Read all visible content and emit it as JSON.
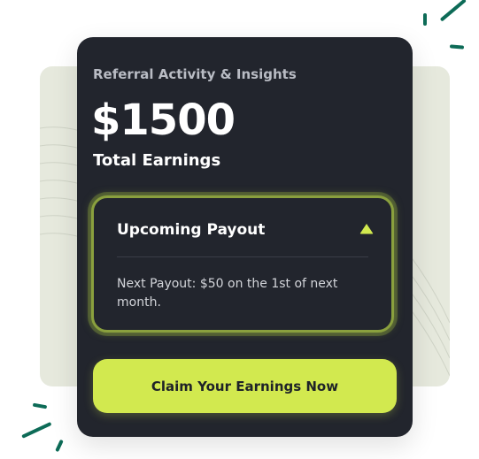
{
  "card": {
    "kicker": "Referral Activity & Insights",
    "amount": "$1500",
    "amount_label": "Total Earnings"
  },
  "payout": {
    "title": "Upcoming Payout",
    "toggle_icon": "triangle-up-icon",
    "text": "Next Payout: $50 on the 1st of next month."
  },
  "cta": {
    "label": "Claim Your Earnings Now"
  },
  "colors": {
    "card_bg": "#22252d",
    "accent": "#d2e94f",
    "glow_border": "#8aa03e",
    "background_panel": "#e6e9dd",
    "decor_dashes": "#0d6b57"
  }
}
